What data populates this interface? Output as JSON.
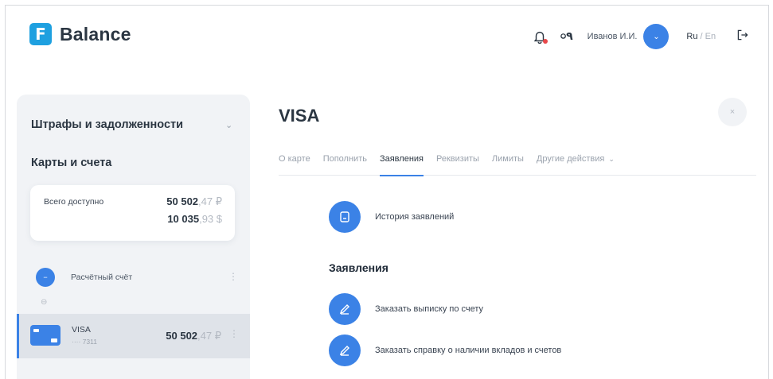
{
  "brand": {
    "logo_letter": "F",
    "name": "Balance"
  },
  "header": {
    "user_name": "Иванов И.И.",
    "lang_active": "Ru",
    "lang_separator": "/",
    "lang_inactive": "En",
    "glasses_glyph": "০٩"
  },
  "sidebar": {
    "fines_title": "Штрафы и задолженности",
    "cards_title": "Карты и счета",
    "total": {
      "label": "Всего доступно",
      "rub_int": "50 502",
      "rub_frac": ",47 ₽",
      "usd_int": "10 035",
      "usd_frac": ",93 $"
    },
    "account": {
      "label": "Расчётный счёт"
    },
    "visa": {
      "name": "VISA",
      "masked_number": "···· 7311",
      "amount_int": "50 502",
      "amount_frac": ",47 ₽"
    }
  },
  "main": {
    "title": "VISA",
    "tabs": [
      {
        "label": "О карте"
      },
      {
        "label": "Пополнить"
      },
      {
        "label": "Заявления"
      },
      {
        "label": "Реквизиты"
      },
      {
        "label": "Лимиты"
      },
      {
        "label": "Другие действия"
      }
    ],
    "active_tab": "Заявления",
    "history_label": "История заявлений",
    "section_title": "Заявления",
    "applications": [
      {
        "label": "Заказать выписку по счету"
      },
      {
        "label": "Заказать справку о наличии вкладов и счетов"
      }
    ]
  },
  "colors": {
    "accent": "#3b82e6",
    "brand": "#1ea0e0",
    "sidebar_bg": "#f1f3f6",
    "notification_dot": "#e8474a"
  },
  "icons": {
    "bell": "bell-icon",
    "glasses": "glasses-icon",
    "logout": "logout-icon",
    "close": "close-icon",
    "document": "document-icon",
    "pencil": "pencil-icon",
    "link": "link-icon",
    "chevron": "chevron-down-icon"
  }
}
